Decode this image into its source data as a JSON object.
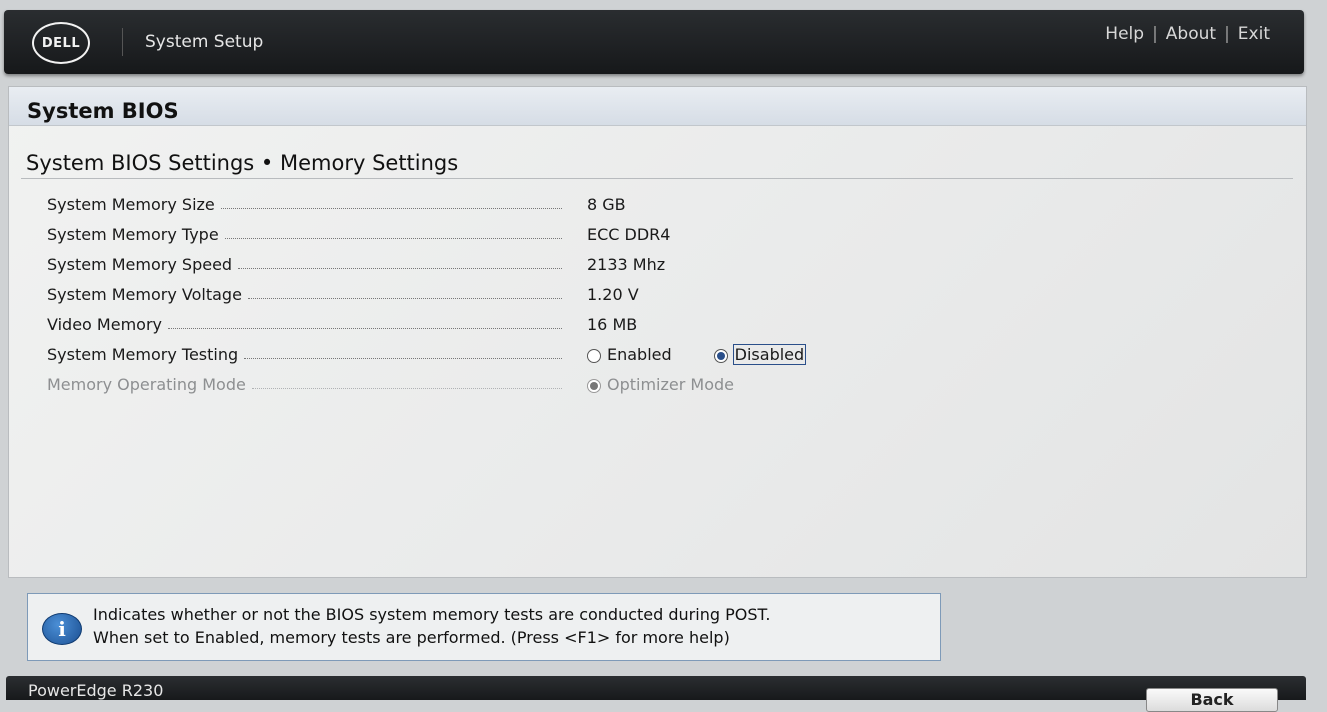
{
  "header": {
    "logo_text": "DELL",
    "title": "System Setup",
    "links": [
      "Help",
      "About",
      "Exit"
    ]
  },
  "panel": {
    "title": "System BIOS",
    "subtitle": "System BIOS Settings • Memory Settings"
  },
  "settings": [
    {
      "label": "System Memory Size",
      "value": "8 GB"
    },
    {
      "label": "System Memory Type",
      "value": "ECC DDR4"
    },
    {
      "label": "System Memory Speed",
      "value": "2133 Mhz"
    },
    {
      "label": "System Memory Voltage",
      "value": "1.20 V"
    },
    {
      "label": "Video Memory",
      "value": "16 MB"
    },
    {
      "label": "System Memory Testing",
      "options": [
        "Enabled",
        "Disabled"
      ],
      "selected": "Disabled"
    },
    {
      "label": "Memory Operating Mode",
      "options": [
        "Optimizer Mode"
      ],
      "selected": "Optimizer Mode",
      "disabled": true
    }
  ],
  "help": {
    "line1": "Indicates whether or not the BIOS system memory tests are conducted during POST.",
    "line2": "When set to Enabled, memory tests are performed. (Press <F1> for more help)"
  },
  "footer": {
    "model": "PowerEdge R230",
    "back_label": "Back"
  },
  "colors": {
    "accent": "#2a4f8a",
    "topbar": "#1f2124"
  }
}
